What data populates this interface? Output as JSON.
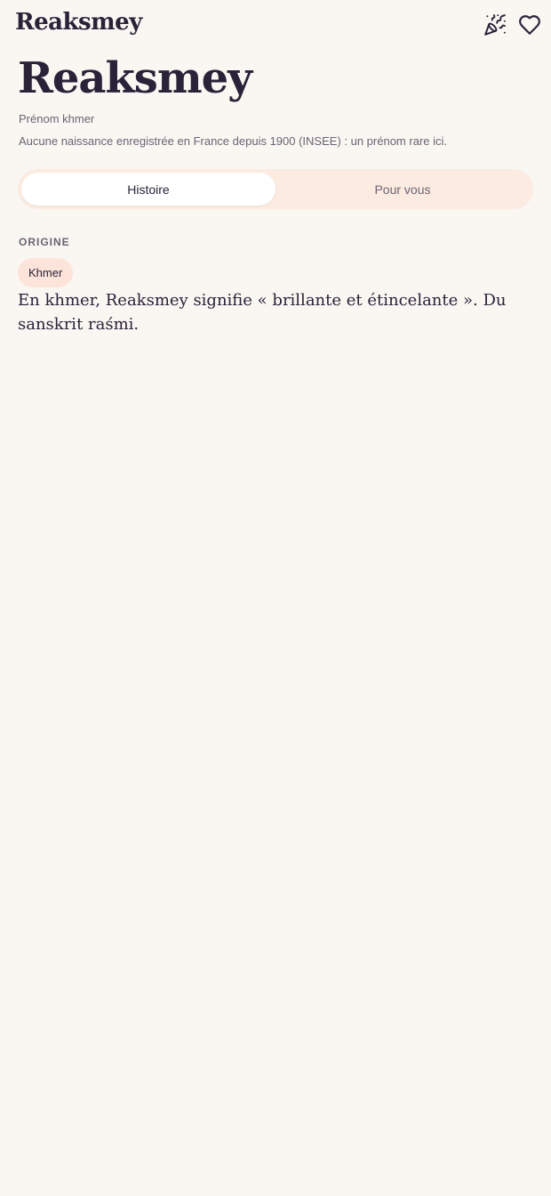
{
  "header": {
    "app_title": "Reaksmey",
    "icons": [
      "party-popper-icon",
      "heart-icon"
    ]
  },
  "name": {
    "title": "Reaksmey",
    "category": "Prénom khmer",
    "rarity_note": "Aucune naissance enregistrée en France depuis 1900 (INSEE) : un prénom rare ici."
  },
  "tabs": [
    {
      "label": "Histoire",
      "active": true
    },
    {
      "label": "Pour vous",
      "active": false
    }
  ],
  "origin": {
    "section_label": "ORIGINE",
    "badge": "Khmer",
    "description": "En khmer, Reaksmey signifie « brillante et étincelante ». Du sanskrit raśmi."
  },
  "colors": {
    "background": "#faf6f2",
    "text": "#2a2238",
    "muted": "#6b6474",
    "tab_track": "#fbebe1",
    "badge": "#fde4da"
  }
}
